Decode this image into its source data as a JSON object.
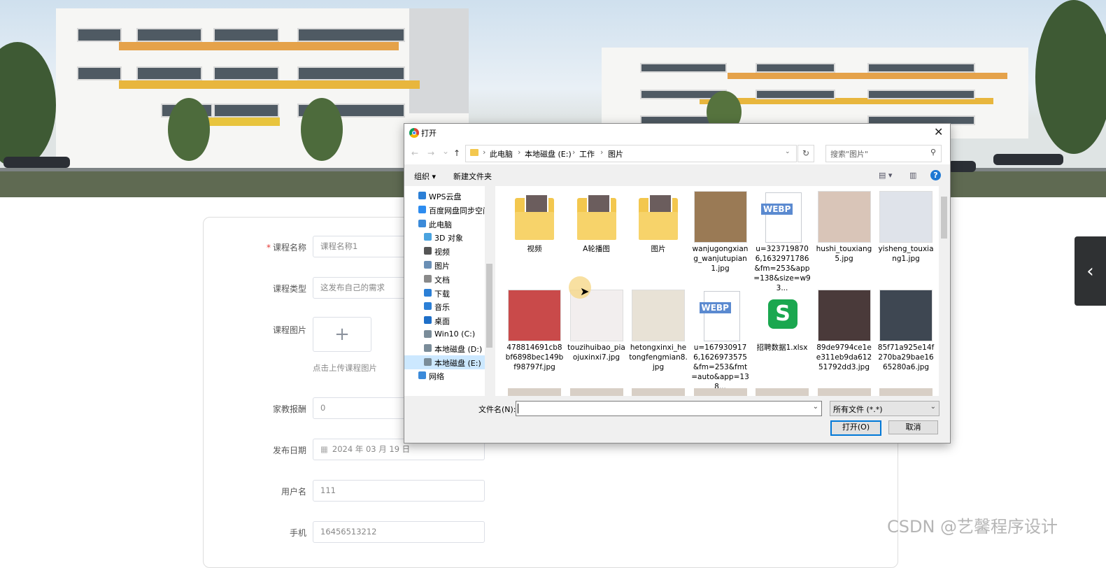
{
  "form": {
    "fields": [
      {
        "label": "课程名称",
        "required": true,
        "value": "课程名称1"
      },
      {
        "label": "课程类型",
        "required": false,
        "value": "这发布自己的需求"
      },
      {
        "label": "课程图片",
        "required": false,
        "upload_tip": "点击上传课程图片"
      },
      {
        "label": "家教报酬",
        "required": false,
        "value": "0"
      },
      {
        "label": "发布日期",
        "required": false,
        "value": "2024 年 03 月 19 日"
      },
      {
        "label": "用户名",
        "required": false,
        "value": "111"
      },
      {
        "label": "手机",
        "required": false,
        "value": "16456513212"
      }
    ],
    "required_mark": "*",
    "upload_plus": "+"
  },
  "side_tab": {
    "icon": "chevron-left-icon",
    "glyph": "‹"
  },
  "watermark": "CSDN @艺馨程序设计",
  "dialog": {
    "title": "打开",
    "close_glyph": "✕",
    "nav": {
      "back": "←",
      "forward": "→",
      "recent": "⌄",
      "up": "↑"
    },
    "breadcrumb": [
      "此电脑",
      "本地磁盘 (E:)",
      "工作",
      "图片"
    ],
    "refresh_glyph": "↻",
    "search_placeholder": "搜索\"图片\"",
    "toolbar": {
      "organize": "组织 ▾",
      "new_folder": "新建文件夹",
      "help": "?"
    },
    "tree": [
      {
        "label": "WPS云盘",
        "icon": "cloud-icon",
        "color": "#2b7fd6",
        "indent": 0
      },
      {
        "label": "百度网盘同步空间",
        "icon": "baidu-netdisk-icon",
        "color": "#2d8cf0",
        "indent": 0
      },
      {
        "label": "此电脑",
        "icon": "computer-icon",
        "color": "#3b8ad9",
        "indent": 0
      },
      {
        "label": "3D 对象",
        "icon": "cube-icon",
        "color": "#4aa3df",
        "indent": 1
      },
      {
        "label": "视频",
        "icon": "video-icon",
        "color": "#555555",
        "indent": 1
      },
      {
        "label": "图片",
        "icon": "picture-icon",
        "color": "#6a8fb5",
        "indent": 1
      },
      {
        "label": "文档",
        "icon": "document-icon",
        "color": "#8a8a8a",
        "indent": 1
      },
      {
        "label": "下载",
        "icon": "download-icon",
        "color": "#2b7fd6",
        "indent": 1
      },
      {
        "label": "音乐",
        "icon": "music-icon",
        "color": "#2b7fd6",
        "indent": 1
      },
      {
        "label": "桌面",
        "icon": "desktop-icon",
        "color": "#1e6fc8",
        "indent": 1
      },
      {
        "label": "Win10 (C:)",
        "icon": "drive-icon",
        "color": "#7a8c99",
        "indent": 1
      },
      {
        "label": "本地磁盘 (D:)",
        "icon": "drive-icon",
        "color": "#7a8c99",
        "indent": 1
      },
      {
        "label": "本地磁盘 (E:)",
        "icon": "drive-icon",
        "color": "#7a8c99",
        "indent": 1,
        "selected": true
      },
      {
        "label": "网络",
        "icon": "network-icon",
        "color": "#3b8ad9",
        "indent": 0
      }
    ],
    "files": [
      {
        "name": "视频",
        "kind": "folder"
      },
      {
        "name": "A轮播图",
        "kind": "folder"
      },
      {
        "name": "图片",
        "kind": "folder"
      },
      {
        "name": "wanjugongxiang_wanjutupian1.jpg",
        "kind": "image",
        "color": "#9a7a55"
      },
      {
        "name": "u=3237198706,1632971786&fm=253&app=138&size=w93...",
        "kind": "webp"
      },
      {
        "name": "hushi_touxiang5.jpg",
        "kind": "image",
        "color": "#d9c5b8"
      },
      {
        "name": "yisheng_touxiang1.jpg",
        "kind": "image",
        "color": "#dfe3ea"
      },
      {
        "name": "478814691cb8bf6898bec149bf98797f.jpg",
        "kind": "image",
        "color": "#c94a4a"
      },
      {
        "name": "touzihuibao_piaojuxinxi7.jpg",
        "kind": "image",
        "color": "#f2eeee"
      },
      {
        "name": "hetongxinxi_hetongfengmian8.jpg",
        "kind": "image",
        "color": "#e8e2d6"
      },
      {
        "name": "u=1679309176,1626973575&fm=253&fmt=auto&app=138...",
        "kind": "webp"
      },
      {
        "name": "招聘数据1.xlsx",
        "kind": "xlsx"
      },
      {
        "name": "89de9794ce1ee311eb9da61251792dd3.jpg",
        "kind": "image",
        "color": "#4a3a3a"
      },
      {
        "name": "85f71a925e14f270ba29bae1665280a6.jpg",
        "kind": "image",
        "color": "#3e4752"
      }
    ],
    "webp_label": "WEBP",
    "xlsx_label": "S",
    "filename_label": "文件名(N):",
    "filename_value": "",
    "filetype": "所有文件 (*.*)",
    "open_btn": "打开(O)",
    "cancel_btn": "取消"
  }
}
